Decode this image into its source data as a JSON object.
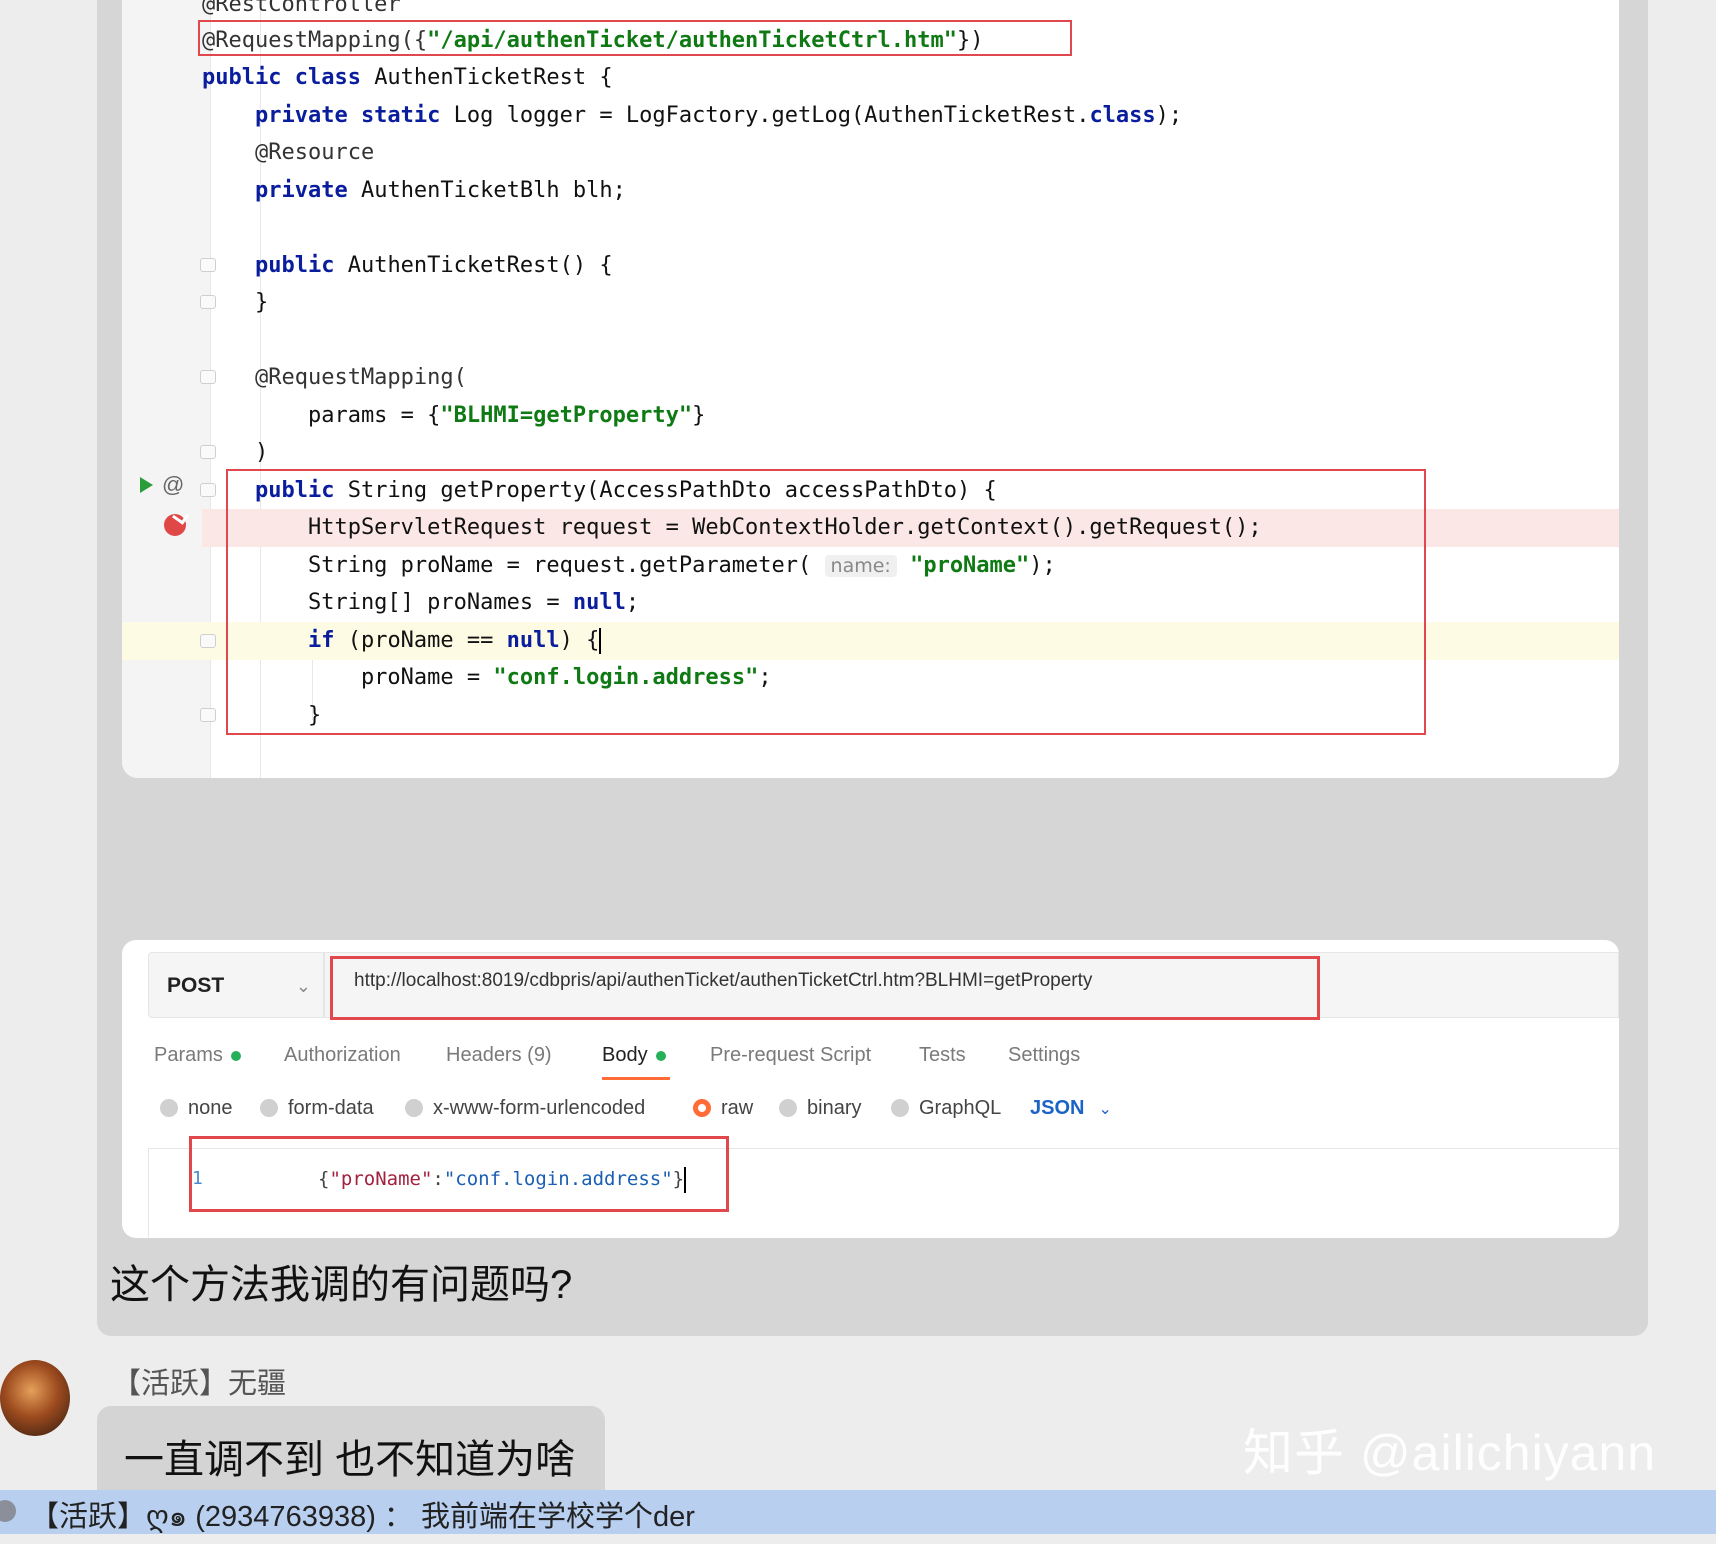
{
  "code": {
    "lines": [
      {
        "parts": [
          {
            "t": "@RestController",
            "c": "ann"
          }
        ]
      },
      {
        "parts": [
          {
            "t": "@RequestMapping({",
            "c": "ann"
          },
          {
            "t": "\"/api/authenTicket/authenTicketCtrl.htm\"",
            "c": "str"
          },
          {
            "t": "})",
            "c": ""
          }
        ]
      },
      {
        "parts": [
          {
            "t": "public class ",
            "c": "kw"
          },
          {
            "t": "AuthenTicketRest {",
            "c": ""
          }
        ]
      },
      {
        "parts": [
          {
            "t": "    private static ",
            "c": "kw"
          },
          {
            "t": "Log logger = LogFactory.getLog(AuthenTicketRest.",
            "c": ""
          },
          {
            "t": "class",
            "c": "kw"
          },
          {
            "t": ");",
            "c": ""
          }
        ]
      },
      {
        "parts": [
          {
            "t": "    @Resource",
            "c": "ann"
          }
        ]
      },
      {
        "parts": [
          {
            "t": "    private ",
            "c": "kw"
          },
          {
            "t": "AuthenTicketBlh blh;",
            "c": ""
          }
        ]
      },
      {
        "parts": [
          {
            "t": "",
            "c": ""
          }
        ]
      },
      {
        "parts": [
          {
            "t": "    public ",
            "c": "kw"
          },
          {
            "t": "AuthenTicketRest() {",
            "c": ""
          }
        ]
      },
      {
        "parts": [
          {
            "t": "    }",
            "c": ""
          }
        ]
      },
      {
        "parts": [
          {
            "t": "",
            "c": ""
          }
        ]
      },
      {
        "parts": [
          {
            "t": "    @RequestMapping(",
            "c": "ann"
          }
        ]
      },
      {
        "parts": [
          {
            "t": "        params = {",
            "c": ""
          },
          {
            "t": "\"BLHMI=getProperty\"",
            "c": "str"
          },
          {
            "t": "}",
            "c": ""
          }
        ]
      },
      {
        "parts": [
          {
            "t": "    )",
            "c": ""
          }
        ]
      },
      {
        "parts": [
          {
            "t": "    public ",
            "c": "kw"
          },
          {
            "t": "String getProperty(AccessPathDto accessPathDto) {",
            "c": ""
          }
        ]
      },
      {
        "parts": [
          {
            "t": "        HttpServletRequest request = WebContextHolder.getContext().getRequest();",
            "c": ""
          }
        ]
      },
      {
        "parts": [
          {
            "t": "        String proName = request.getParameter( ",
            "c": ""
          },
          {
            "t": "name:",
            "c": "hint"
          },
          {
            "t": " ",
            "c": ""
          },
          {
            "t": "\"proName\"",
            "c": "str"
          },
          {
            "t": ");",
            "c": ""
          }
        ]
      },
      {
        "parts": [
          {
            "t": "        String[] proNames = ",
            "c": ""
          },
          {
            "t": "null",
            "c": "kw"
          },
          {
            "t": ";",
            "c": ""
          }
        ]
      },
      {
        "parts": [
          {
            "t": "        if ",
            "c": "kw"
          },
          {
            "t": "(proName == ",
            "c": ""
          },
          {
            "t": "null",
            "c": "kw"
          },
          {
            "t": ") {",
            "c": ""
          }
        ]
      },
      {
        "parts": [
          {
            "t": "            proName = ",
            "c": ""
          },
          {
            "t": "\"conf.login.address\"",
            "c": "str"
          },
          {
            "t": ";",
            "c": ""
          }
        ]
      },
      {
        "parts": [
          {
            "t": "        }",
            "c": ""
          }
        ]
      }
    ]
  },
  "postman": {
    "method": "POST",
    "url": "http://localhost:8019/cdbpris/api/authenTicket/authenTicketCtrl.htm?BLHMI=getProperty",
    "tabs": [
      "Params",
      "Authorization",
      "Headers (9)",
      "Body",
      "Pre-request Script",
      "Tests",
      "Settings"
    ],
    "body_types": [
      "none",
      "form-data",
      "x-www-form-urlencoded",
      "raw",
      "binary",
      "GraphQL"
    ],
    "body_format": "JSON",
    "body_line_number": "1",
    "body_key": "\"proName\"",
    "body_colon": ":",
    "body_value": "\"conf.login.address\"",
    "brace_open": "{",
    "brace_close": "}"
  },
  "chat": {
    "question": "这个方法我调的有问题吗?",
    "sender": "【活跃】无疆",
    "message": "一直调不到 也不知道为啥",
    "watermark": "知乎 @ailichiyann",
    "banner": "【活跃】ღ๑ (2934763938) ： 我前端在学校学个der"
  },
  "colors": {
    "keyword": "#0a1d9c",
    "string": "#0f7a14",
    "annotation_box": "#e0484e",
    "postman_accent": "#ff6c37",
    "active_dot": "#26b05a"
  }
}
